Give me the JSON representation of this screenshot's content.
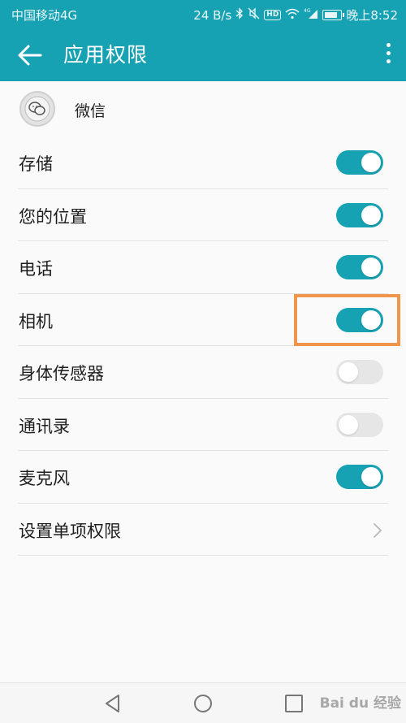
{
  "status_bar": {
    "carrier": "中国移动4G",
    "speed": "24 B/s",
    "hd_label": "HD",
    "signal_label": "4G",
    "time": "晚上8:52",
    "battery_level": 0.85,
    "icons": [
      "bluetooth-icon",
      "mute-icon",
      "wifi-icon",
      "signal-icon",
      "battery-icon"
    ]
  },
  "header": {
    "title": "应用权限",
    "accent_color": "#17a2b4"
  },
  "app": {
    "name": "微信"
  },
  "permissions": [
    {
      "label": "存储",
      "enabled": true
    },
    {
      "label": "您的位置",
      "enabled": true
    },
    {
      "label": "电话",
      "enabled": true
    },
    {
      "label": "相机",
      "enabled": true,
      "highlighted": true
    },
    {
      "label": "身体传感器",
      "enabled": false
    },
    {
      "label": "通讯录",
      "enabled": false
    },
    {
      "label": "麦克风",
      "enabled": true
    }
  ],
  "single_permission": {
    "label": "设置单项权限"
  },
  "highlight_color": "#f0964c",
  "watermark": "Bai du 经验"
}
